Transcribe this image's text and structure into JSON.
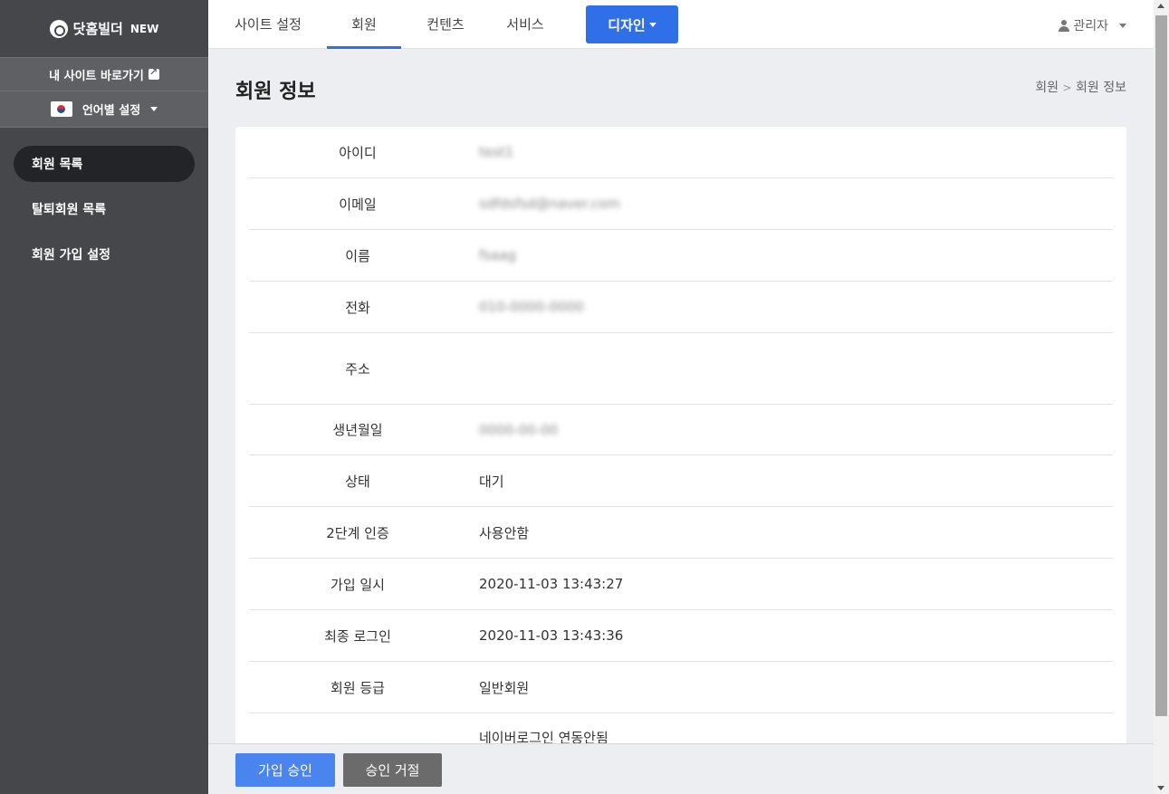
{
  "sidebar": {
    "logo_text": "닷홈빌더",
    "logo_badge": "NEW",
    "site_link": "내 사이트 바로가기",
    "language": "언어별 설정",
    "nav": [
      {
        "label": "회원 목록"
      },
      {
        "label": "탈퇴회원 목록"
      },
      {
        "label": "회원 가입 설정"
      }
    ]
  },
  "topbar": {
    "tabs": [
      {
        "label": "사이트 설정"
      },
      {
        "label": "회원"
      },
      {
        "label": "컨텐츠"
      },
      {
        "label": "서비스"
      }
    ],
    "active_tab": "회원",
    "design_button": "디자인",
    "admin": "관리자"
  },
  "page": {
    "title": "회원 정보",
    "breadcrumb_parent": "회원",
    "breadcrumb_separator": ">",
    "breadcrumb_current": "회원 정보"
  },
  "member": {
    "rows": [
      {
        "label": "아이디",
        "value": "test1"
      },
      {
        "label": "이메일",
        "value": "sdfdsfsd@naver.com"
      },
      {
        "label": "이름",
        "value": "fsaag"
      },
      {
        "label": "전화",
        "value": "010-0000-0000"
      },
      {
        "label": "주소",
        "value": ""
      },
      {
        "label": "생년월일",
        "value": "0000-00-00"
      },
      {
        "label": "상태",
        "value": "대기"
      },
      {
        "label": "2단계 인증",
        "value": "사용안함"
      },
      {
        "label": "가입 일시",
        "value": "2020-11-03 13:43:27"
      },
      {
        "label": "최종 로그인",
        "value": "2020-11-03 13:43:36"
      },
      {
        "label": "회원 등급",
        "value": "일반회원"
      },
      {
        "label": "",
        "value": "네이버로그인 연동안됨"
      }
    ]
  },
  "footer": {
    "approve": "가입 승인",
    "reject": "승인 거절"
  },
  "colors": {
    "accent": "#2f6fe8",
    "sidebar": "#45474b"
  }
}
